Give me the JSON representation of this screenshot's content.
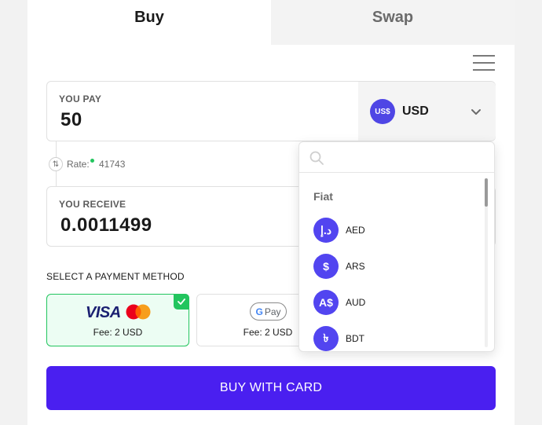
{
  "tabs": {
    "buy": "Buy",
    "swap": "Swap"
  },
  "pay": {
    "label": "YOU PAY",
    "value": "50",
    "currency_badge": "US$",
    "currency_code": "USD"
  },
  "rate": {
    "label": "Rate:",
    "value": "41743"
  },
  "receive": {
    "label": "YOU RECEIVE",
    "value": "0.0011499"
  },
  "payment": {
    "title": "SELECT A PAYMENT METHOD",
    "methods": [
      {
        "brand": "VISA",
        "fee": "Fee: 2 USD",
        "selected": true
      },
      {
        "brand_g": "G",
        "brand": "Pay",
        "fee": "Fee: 2 USD",
        "selected": false
      }
    ]
  },
  "buy_button": "BUY WITH CARD",
  "dropdown": {
    "search_placeholder": "",
    "group": "Fiat",
    "items": [
      {
        "symbol": "د.إ",
        "code": "AED"
      },
      {
        "symbol": "$",
        "code": "ARS"
      },
      {
        "symbol": "A$",
        "code": "AUD"
      },
      {
        "symbol": "৳",
        "code": "BDT"
      }
    ]
  },
  "colors": {
    "accent": "#4a1ff0",
    "badge": "#5245f0",
    "success": "#22c55e"
  },
  "icons": [
    "menu-icon",
    "chevron-down-icon",
    "swap-arrows-icon",
    "check-icon",
    "mastercard-icon",
    "search-icon"
  ]
}
